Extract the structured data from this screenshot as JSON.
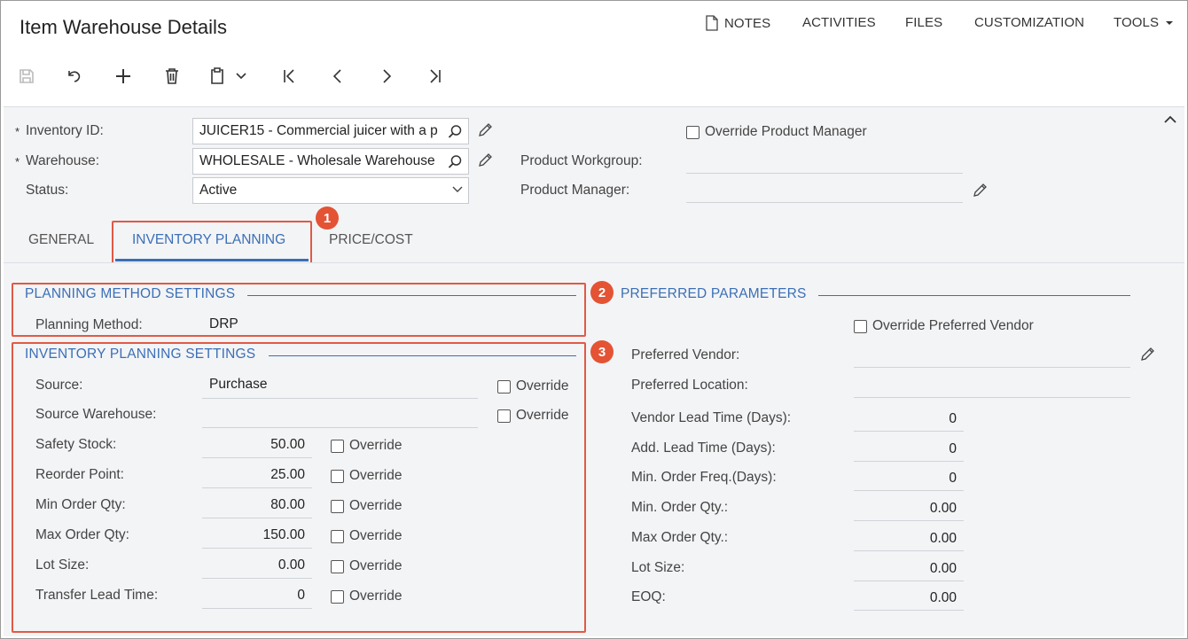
{
  "page": {
    "title": "Item Warehouse Details"
  },
  "topnav": {
    "notes": "NOTES",
    "activities": "ACTIVITIES",
    "files": "FILES",
    "customization": "CUSTOMIZATION",
    "tools": "TOOLS"
  },
  "header": {
    "inventory_id": {
      "label": "Inventory ID:",
      "value": "JUICER15 - Commercial juicer with a p"
    },
    "warehouse": {
      "label": "Warehouse:",
      "value": "WHOLESALE - Wholesale Warehouse"
    },
    "status": {
      "label": "Status:",
      "value": "Active"
    },
    "override_pm": {
      "label": "Override Product Manager"
    },
    "product_workgroup": {
      "label": "Product Workgroup:",
      "value": ""
    },
    "product_manager": {
      "label": "Product Manager:",
      "value": ""
    },
    "required_mark": "*"
  },
  "tabs": [
    {
      "label": "GENERAL"
    },
    {
      "label": "INVENTORY PLANNING"
    },
    {
      "label": "PRICE/COST"
    }
  ],
  "callouts": [
    "1",
    "2",
    "3"
  ],
  "planning_method": {
    "title": "PLANNING METHOD SETTINGS",
    "label": "Planning Method:",
    "value": "DRP"
  },
  "inventory_planning": {
    "title": "INVENTORY PLANNING SETTINGS",
    "override_label": "Override",
    "source": {
      "label": "Source:",
      "value": "Purchase"
    },
    "source_warehouse": {
      "label": "Source Warehouse:",
      "value": ""
    },
    "rows": [
      {
        "label": "Safety Stock:",
        "value": "50.00"
      },
      {
        "label": "Reorder Point:",
        "value": "25.00"
      },
      {
        "label": "Min Order Qty:",
        "value": "80.00"
      },
      {
        "label": "Max Order Qty:",
        "value": "150.00"
      },
      {
        "label": "Lot Size:",
        "value": "0.00"
      },
      {
        "label": "Transfer Lead Time:",
        "value": "0"
      }
    ]
  },
  "preferred": {
    "title": "PREFERRED PARAMETERS",
    "override_vendor": "Override Preferred Vendor",
    "vendor": {
      "label": "Preferred Vendor:",
      "value": ""
    },
    "location": {
      "label": "Preferred Location:",
      "value": ""
    },
    "rows": [
      {
        "label": "Vendor Lead Time (Days):",
        "value": "0"
      },
      {
        "label": "Add. Lead Time (Days):",
        "value": "0"
      },
      {
        "label": "Min. Order Freq.(Days):",
        "value": "0"
      },
      {
        "label": "Min. Order Qty.:",
        "value": "0.00"
      },
      {
        "label": "Max Order Qty.:",
        "value": "0.00"
      },
      {
        "label": "Lot Size:",
        "value": "0.00"
      },
      {
        "label": "EOQ:",
        "value": "0.00"
      }
    ]
  },
  "colors": {
    "accent": "#3b6fb6",
    "callout": "#e35334"
  },
  "icons": [
    "save-icon",
    "undo-icon",
    "add-icon",
    "delete-icon",
    "copy-paste-icon",
    "first-record-icon",
    "previous-record-icon",
    "next-record-icon",
    "last-record-icon",
    "search-icon",
    "edit-pencil-icon",
    "chevron-down-icon",
    "collapse-icon",
    "notes-icon"
  ]
}
